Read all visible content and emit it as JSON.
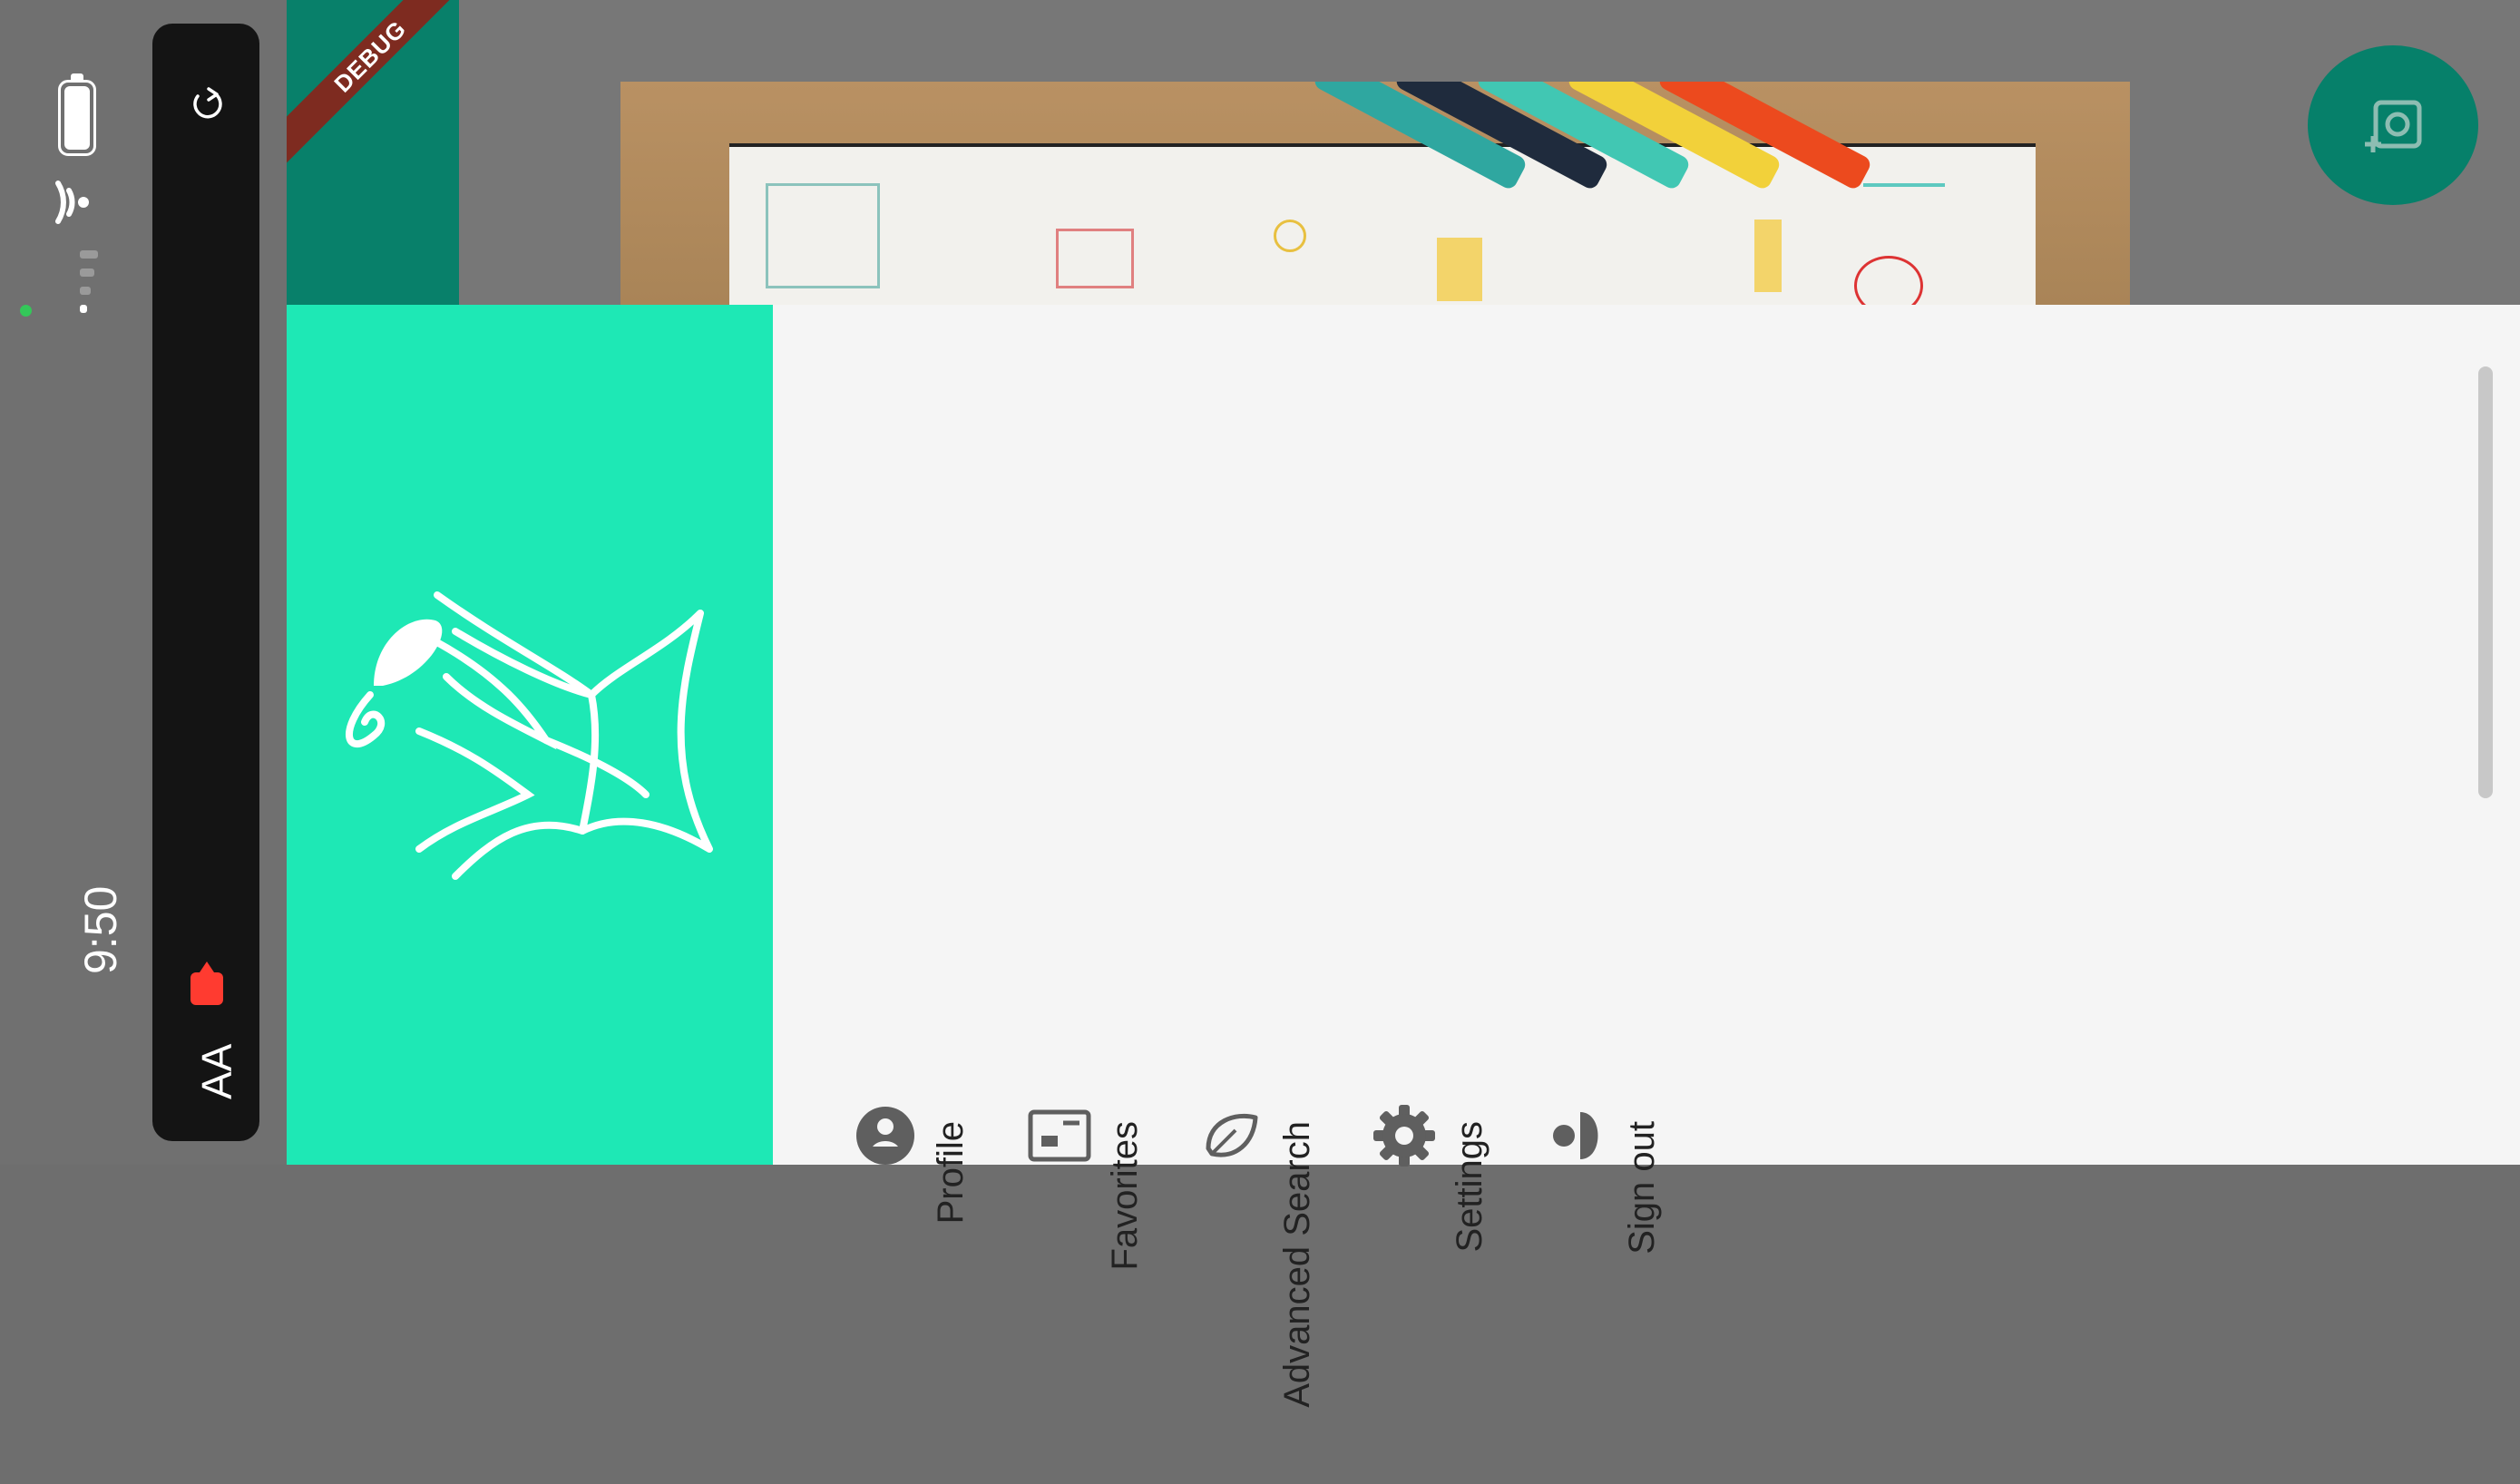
{
  "status": {
    "time": "9:50",
    "text_size_label": "AA"
  },
  "app": {
    "debug_banner": "DEBUG",
    "fab_icon": "add-photo-icon"
  },
  "drawer": {
    "header_color": "#1ee8b5",
    "items": [
      {
        "label": "Profile",
        "icon": "profile-icon"
      },
      {
        "label": "Favorites",
        "icon": "favorites-icon"
      },
      {
        "label": "Advanced Search",
        "icon": "leaf-icon"
      },
      {
        "label": "Settings",
        "icon": "gear-icon"
      },
      {
        "label": "Sign out",
        "icon": "sign-out-icon"
      }
    ]
  }
}
